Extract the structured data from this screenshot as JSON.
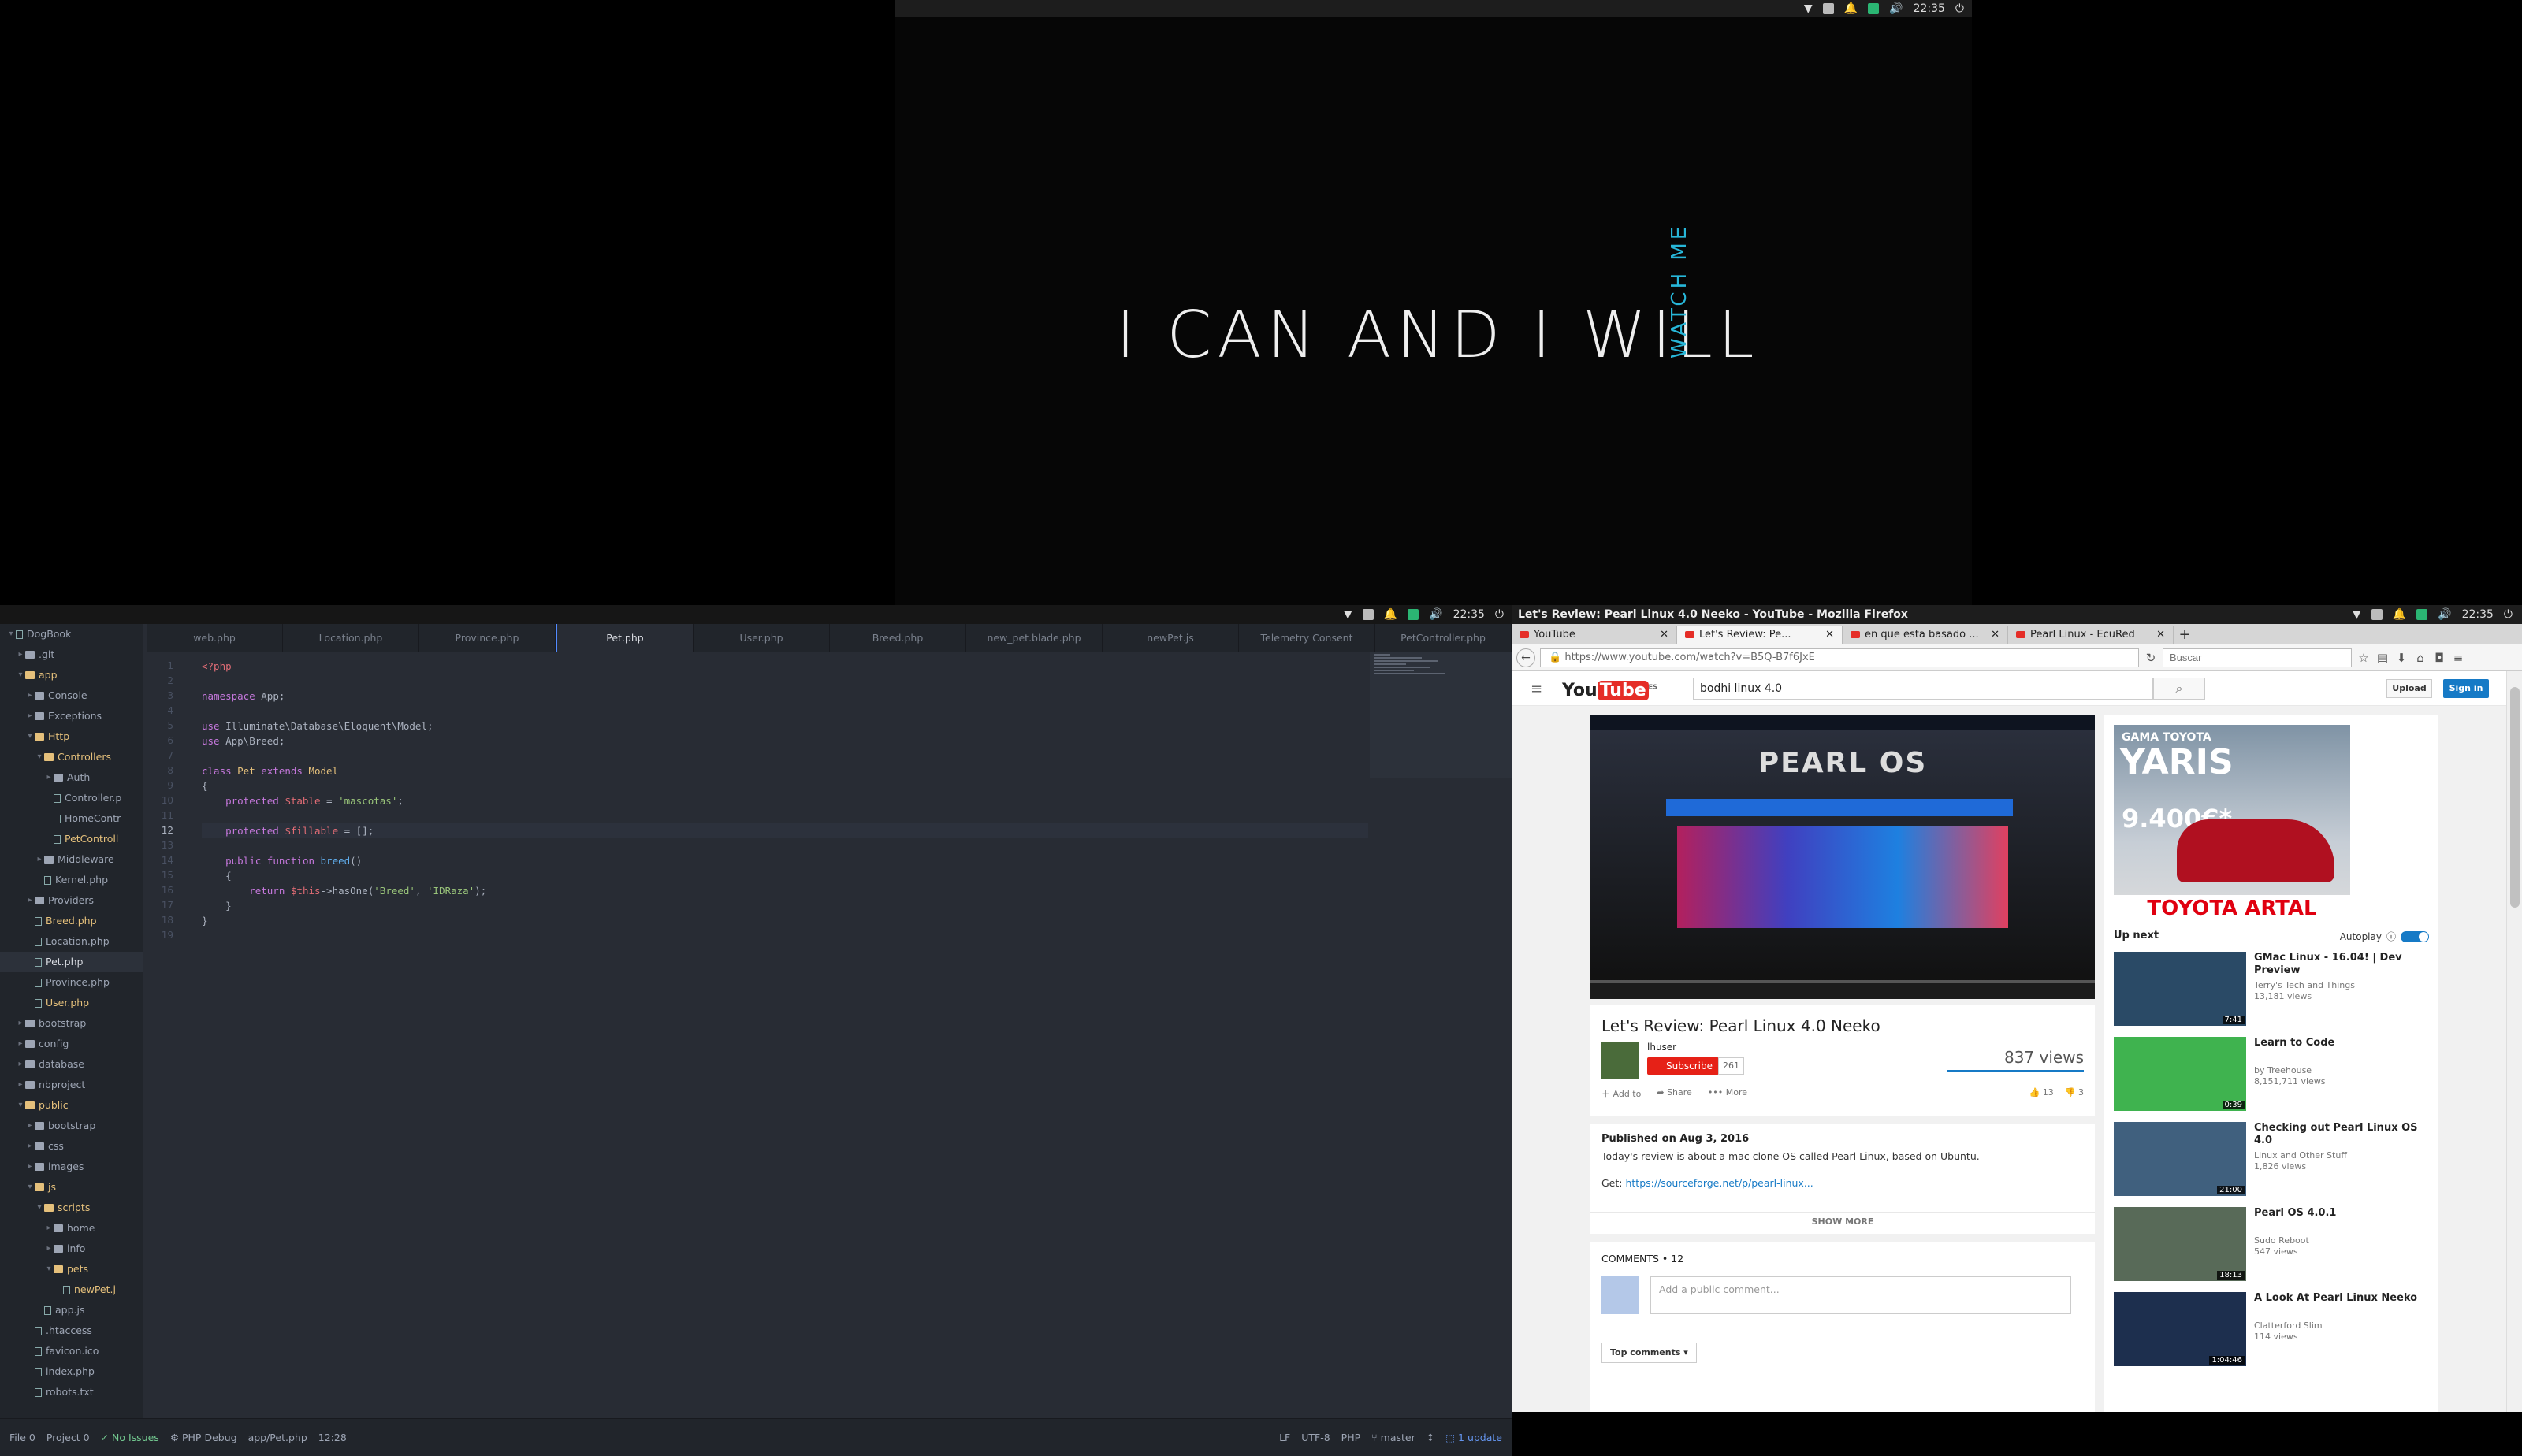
{
  "desktop": {
    "clock": "22:35",
    "wallpaper_text": "I CAN AND I WILL",
    "wallpaper_side_text": "WATCH ME"
  },
  "atom": {
    "project": "DogBook",
    "tree": [
      {
        "label": ".git",
        "depth": 1,
        "type": "folder",
        "open": false
      },
      {
        "label": "app",
        "depth": 1,
        "type": "folder",
        "open": true
      },
      {
        "label": "Console",
        "depth": 2,
        "type": "folder",
        "open": false
      },
      {
        "label": "Exceptions",
        "depth": 2,
        "type": "folder",
        "open": false
      },
      {
        "label": "Http",
        "depth": 2,
        "type": "folder",
        "open": true
      },
      {
        "label": "Controllers",
        "depth": 3,
        "type": "folder",
        "open": true
      },
      {
        "label": "Auth",
        "depth": 4,
        "type": "folder",
        "open": false
      },
      {
        "label": "Controller.p",
        "depth": 4,
        "type": "file"
      },
      {
        "label": "HomeContr",
        "depth": 4,
        "type": "file"
      },
      {
        "label": "PetControll",
        "depth": 4,
        "type": "file",
        "modified": true
      },
      {
        "label": "Middleware",
        "depth": 3,
        "type": "folder",
        "open": false
      },
      {
        "label": "Kernel.php",
        "depth": 3,
        "type": "file"
      },
      {
        "label": "Providers",
        "depth": 2,
        "type": "folder",
        "open": false
      },
      {
        "label": "Breed.php",
        "depth": 2,
        "type": "file",
        "modified": true
      },
      {
        "label": "Location.php",
        "depth": 2,
        "type": "file"
      },
      {
        "label": "Pet.php",
        "depth": 2,
        "type": "file",
        "selected": true
      },
      {
        "label": "Province.php",
        "depth": 2,
        "type": "file"
      },
      {
        "label": "User.php",
        "depth": 2,
        "type": "file",
        "modified": true
      },
      {
        "label": "bootstrap",
        "depth": 1,
        "type": "folder",
        "open": false
      },
      {
        "label": "config",
        "depth": 1,
        "type": "folder",
        "open": false
      },
      {
        "label": "database",
        "depth": 1,
        "type": "folder",
        "open": false
      },
      {
        "label": "nbproject",
        "depth": 1,
        "type": "folder",
        "open": false
      },
      {
        "label": "public",
        "depth": 1,
        "type": "folder",
        "open": true
      },
      {
        "label": "bootstrap",
        "depth": 2,
        "type": "folder",
        "open": false
      },
      {
        "label": "css",
        "depth": 2,
        "type": "folder",
        "open": false
      },
      {
        "label": "images",
        "depth": 2,
        "type": "folder",
        "open": false
      },
      {
        "label": "js",
        "depth": 2,
        "type": "folder",
        "open": true
      },
      {
        "label": "scripts",
        "depth": 3,
        "type": "folder",
        "open": true
      },
      {
        "label": "home",
        "depth": 4,
        "type": "folder",
        "open": false
      },
      {
        "label": "info",
        "depth": 4,
        "type": "folder",
        "open": false
      },
      {
        "label": "pets",
        "depth": 4,
        "type": "folder",
        "open": true
      },
      {
        "label": "newPet.j",
        "depth": 5,
        "type": "file",
        "modified": true
      },
      {
        "label": "app.js",
        "depth": 3,
        "type": "file"
      },
      {
        "label": ".htaccess",
        "depth": 2,
        "type": "file"
      },
      {
        "label": "favicon.ico",
        "depth": 2,
        "type": "file"
      },
      {
        "label": "index.php",
        "depth": 2,
        "type": "file"
      },
      {
        "label": "robots.txt",
        "depth": 2,
        "type": "file"
      }
    ],
    "tabs": [
      "web.php",
      "Location.php",
      "Province.php",
      "Pet.php",
      "User.php",
      "Breed.php",
      "new_pet.blade.php",
      "newPet.js",
      "Telemetry Consent",
      "PetController.php"
    ],
    "active_tab": 3,
    "current_line": 12,
    "code_lines": [
      [
        {
          "t": "<?php",
          "c": "tag"
        }
      ],
      [],
      [
        {
          "t": "namespace ",
          "c": "kw"
        },
        {
          "t": "App;",
          "c": ""
        }
      ],
      [],
      [
        {
          "t": "use ",
          "c": "kw"
        },
        {
          "t": "Illuminate\\Database\\Eloquent\\Model;",
          "c": ""
        }
      ],
      [
        {
          "t": "use ",
          "c": "kw"
        },
        {
          "t": "App\\Breed;",
          "c": ""
        }
      ],
      [],
      [
        {
          "t": "class ",
          "c": "kw"
        },
        {
          "t": "Pet ",
          "c": "cls"
        },
        {
          "t": "extends ",
          "c": "kw"
        },
        {
          "t": "Model",
          "c": "cls"
        }
      ],
      [
        {
          "t": "{",
          "c": ""
        }
      ],
      [
        {
          "t": "    protected ",
          "c": "kw"
        },
        {
          "t": "$table",
          "c": "var"
        },
        {
          "t": " = ",
          "c": ""
        },
        {
          "t": "'mascotas'",
          "c": "str"
        },
        {
          "t": ";",
          "c": ""
        }
      ],
      [],
      [
        {
          "t": "    protected ",
          "c": "kw"
        },
        {
          "t": "$fillable",
          "c": "var"
        },
        {
          "t": " = [];",
          "c": ""
        }
      ],
      [],
      [
        {
          "t": "    public ",
          "c": "kw"
        },
        {
          "t": "function ",
          "c": "kw"
        },
        {
          "t": "breed",
          "c": "fn"
        },
        {
          "t": "()",
          "c": ""
        }
      ],
      [
        {
          "t": "    {",
          "c": ""
        }
      ],
      [
        {
          "t": "        return ",
          "c": "kw"
        },
        {
          "t": "$this",
          "c": "var"
        },
        {
          "t": "->hasOne(",
          "c": ""
        },
        {
          "t": "'Breed'",
          "c": "str"
        },
        {
          "t": ", ",
          "c": ""
        },
        {
          "t": "'IDRaza'",
          "c": "str"
        },
        {
          "t": ");",
          "c": ""
        }
      ],
      [
        {
          "t": "    }",
          "c": ""
        }
      ],
      [
        {
          "t": "}",
          "c": ""
        }
      ],
      []
    ],
    "status": {
      "file": "File 0",
      "project": "Project 0",
      "issues": "No Issues",
      "debug": "PHP Debug",
      "path": "app/Pet.php",
      "cursor": "12:28",
      "eol": "LF",
      "encoding": "UTF-8",
      "grammar": "PHP",
      "branch": "master",
      "update": "1 update"
    }
  },
  "firefox": {
    "window_title": "Let's Review: Pearl Linux 4.0 Neeko - YouTube - Mozilla Firefox",
    "tabs": [
      {
        "label": "YouTube",
        "active": false
      },
      {
        "label": "Let's Review: Pe...",
        "active": true
      },
      {
        "label": "en que esta basado ...",
        "active": false
      },
      {
        "label": "Pearl Linux - EcuRed",
        "active": false
      }
    ],
    "url": "https://www.youtube.com/watch?v=B5Q-B7f6JxE",
    "search_placeholder": "Buscar"
  },
  "youtube": {
    "logo_you": "You",
    "logo_tube": "Tube",
    "logo_region": "ES",
    "search_query": "bodhi linux 4.0",
    "upload": "Upload",
    "signin": "Sign in",
    "player_brand": "PEARL OS",
    "video_title": "Let's Review: Pearl Linux 4.0 Neeko",
    "channel": "lhuser",
    "subscribe": "Subscribe",
    "subscriber_count": "261",
    "views": "837 views",
    "likes": "13",
    "dislikes": "3",
    "add_to": "Add to",
    "share": "Share",
    "more": "More",
    "published": "Published on Aug 3, 2016",
    "description": "Today's review is about a mac clone OS called Pearl Linux, based on Ubuntu.",
    "get_label": "Get: ",
    "get_link": "https://sourceforge.net/p/pearl-linux...",
    "show_more": "SHOW MORE",
    "comments_header": "COMMENTS • 12",
    "comment_placeholder": "Add a public comment...",
    "top_comments": "Top comments",
    "ad": {
      "line1": "GAMA TOYOTA",
      "line2": "YARIS",
      "price": "9.400€*",
      "footer": "TOYOTA ARTAL"
    },
    "up_next": "Up next",
    "autoplay": "Autoplay",
    "recommendations": [
      {
        "title": "GMac Linux - 16.04! | Dev Preview",
        "channel": "Terry's Tech and Things",
        "views": "13,181 views",
        "duration": "7:41",
        "thumb": "#2a4a66"
      },
      {
        "title": "Learn to Code",
        "channel": "by Treehouse",
        "views": "8,151,711 views",
        "duration": "0:39",
        "thumb": "#3fb34f"
      },
      {
        "title": "Checking out Pearl Linux OS 4.0",
        "channel": "Linux and Other Stuff",
        "views": "1,826 views",
        "duration": "21:00",
        "thumb": "#40607e"
      },
      {
        "title": "Pearl OS 4.0.1",
        "channel": "Sudo Reboot",
        "views": "547 views",
        "duration": "18:13",
        "thumb": "#586a58"
      },
      {
        "title": "A Look At Pearl Linux Neeko",
        "channel": "Clatterford Slim",
        "views": "114 views",
        "duration": "1:04:46",
        "thumb": "#1d2f4e"
      }
    ]
  }
}
